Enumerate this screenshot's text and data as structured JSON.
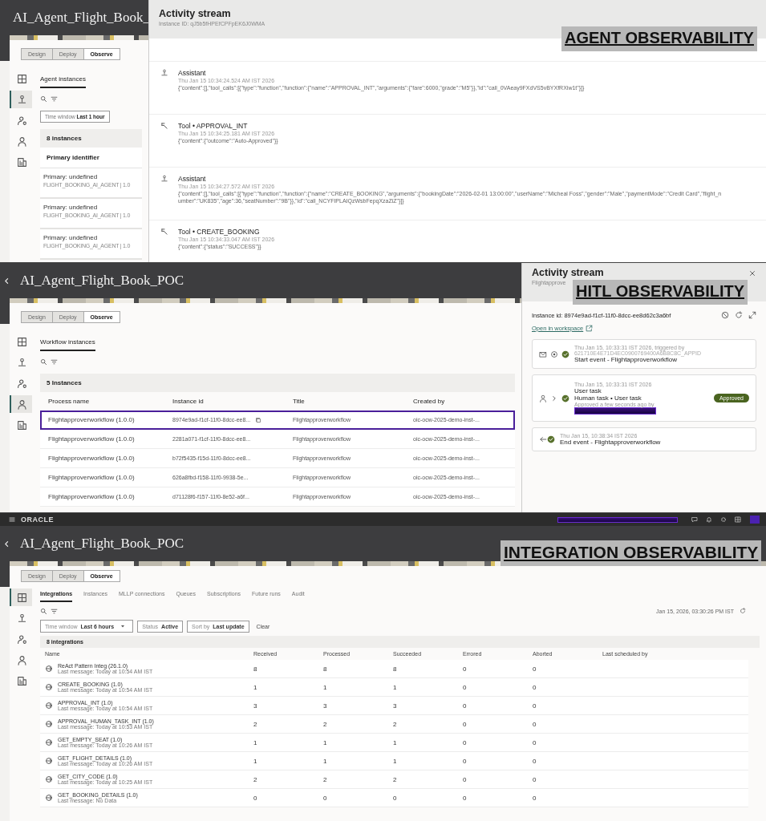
{
  "agent_panel": {
    "app_title": "AI_Agent_Flight_Book_",
    "mode_tabs": [
      {
        "label": "Design",
        "selected": false
      },
      {
        "label": "Deploy",
        "selected": false
      },
      {
        "label": "Observe",
        "selected": true
      }
    ],
    "nav": [
      {
        "kind": "grid",
        "selected": false
      },
      {
        "kind": "agent",
        "selected": true
      },
      {
        "kind": "workflow",
        "selected": false
      },
      {
        "kind": "person",
        "selected": false
      },
      {
        "kind": "report",
        "selected": false
      }
    ],
    "section_tab": "Agent instances",
    "filter": {
      "label": "Time window",
      "value": "Last 1 hour"
    },
    "count": "8 instances",
    "column": "Primary identifier",
    "rows": [
      {
        "primary": "Primary: undefined",
        "agent": "FLIGHT_BOOKING_AI_AGENT | 1.0"
      },
      {
        "primary": "Primary: undefined",
        "agent": "FLIGHT_BOOKING_AI_AGENT | 1.0"
      },
      {
        "primary": "Primary: undefined",
        "agent": "FLIGHT_BOOKING_AI_AGENT | 1.0"
      }
    ],
    "stream": {
      "title": "Activity stream",
      "subtitle": "Instance ID: qJ5b5fHPEfCPFpEK6J0WMA",
      "entries": [
        {
          "kind": "assistant",
          "role": "Assistant",
          "time": "Thu Jan 15 10:34:24.524 AM IST 2026",
          "body": "{\"content\":[],\"tool_calls\":[{\"type\":\"function\",\"function\":{\"name\":\"APPROVAL_INT\",\"arguments\":{\"fare\":6000,\"grade\":\"M5\"}},\"id\":\"call_0VAeay9FXdVS5vBYXfRXiw1t\"}]}"
        },
        {
          "kind": "tool",
          "role": "Tool • APPROVAL_INT",
          "time": "Thu Jan 15 10:34:25.181 AM IST 2026",
          "body": "{\"content\":{\"outcome\":\"Auto-Approved\"}}"
        },
        {
          "kind": "assistant",
          "role": "Assistant",
          "time": "Thu Jan 15 10:34:27.572 AM IST 2026",
          "body": "{\"content\":[],\"tool_calls\":[{\"type\":\"function\",\"function\":{\"name\":\"CREATE_BOOKING\",\"arguments\":{\"bookingDate\":\"2026-02-01 13:00:00\",\"userName\":\"Micheal Foss\",\"gender\":\"Male\",\"paymentMode\":\"Credit Card\",\"flight_number\":\"UK835\",\"age\":36,\"seatNumber\":\"9B\"}},\"id\":\"call_NCYFIPLAIQzWsbFepqXzaZiZ\"}]}"
        },
        {
          "kind": "tool",
          "role": "Tool • CREATE_BOOKING",
          "time": "Thu Jan 15 10:34:33.047 AM IST 2026",
          "body": "{\"content\":{\"status\":\"SUCCESS\"}}"
        }
      ]
    },
    "banner": "AGENT OBSERVABILITY"
  },
  "hitl_panel": {
    "app_title": "AI_Agent_Flight_Book_POC",
    "mode_tabs": [
      {
        "label": "Design",
        "selected": false
      },
      {
        "label": "Deploy",
        "selected": false
      },
      {
        "label": "Observe",
        "selected": true
      }
    ],
    "nav": [
      {
        "kind": "grid",
        "selected": false
      },
      {
        "kind": "agent",
        "selected": false
      },
      {
        "kind": "workflow",
        "selected": false
      },
      {
        "kind": "person",
        "selected": true
      },
      {
        "kind": "report",
        "selected": false
      }
    ],
    "section_tab": "Workflow instances",
    "count": "5 Instances",
    "columns": [
      "Process name",
      "Instance id",
      "Title",
      "Created by"
    ],
    "rows": [
      {
        "process": "Flightapproverworkflow (1.0.0)",
        "instance_id": "8974e9ad-f1cf-11f0-8dcc-ee8...",
        "title": "Flightapproverworkflow",
        "created_by": "oic-ocw-2025-demo-inst-...",
        "selected": true
      },
      {
        "process": "Flightapproverworkflow (1.0.0)",
        "instance_id": "2281a071-f1cf-11f0-8dcc-ee8...",
        "title": "Flightapproverworkflow",
        "created_by": "oic-ocw-2025-demo-inst-...",
        "selected": false
      },
      {
        "process": "Flightapproverworkflow (1.0.0)",
        "instance_id": "b72f5435-f15d-11f0-8dcc-ee8...",
        "title": "Flightapproverworkflow",
        "created_by": "oic-ocw-2025-demo-inst-...",
        "selected": false
      },
      {
        "process": "Flightapproverworkflow (1.0.0)",
        "instance_id": "626a8fbd-f158-11f0-9938-5e...",
        "title": "Flightapproverworkflow",
        "created_by": "oic-ocw-2025-demo-inst-...",
        "selected": false
      },
      {
        "process": "Flightapproverworkflow (1.0.0)",
        "instance_id": "d71128f6-f157-11f0-8e52-a6f...",
        "title": "Flightapproverworkflow",
        "created_by": "oic-ocw-2025-demo-inst-...",
        "selected": false
      }
    ],
    "stream": {
      "title": "Activity stream",
      "subtitle": "Flightapprove",
      "instance": "Instance id: 8974e9ad-f1cf-11f0-8dcc-ee8d62c3a6bf",
      "link": "Open in workspace",
      "events": [
        {
          "kind": "start",
          "time": "Thu Jan 15, 10:33:31 IST 2026, triggered by",
          "detail": "621710E4E71D4EC0900769400A6B8C8C_APPID",
          "title": "Start event - Flightapproverworkflow"
        },
        {
          "kind": "user_task",
          "time": "Thu Jan 15, 10:33:31 IST 2026",
          "title": "User task",
          "detail": "Human task • User task",
          "note": "Approved a few seconds ago by",
          "status": "Approved"
        },
        {
          "kind": "end",
          "time": "Thu Jan 15, 10:38:34 IST 2026",
          "title": "End event - Flightapproverworkflow"
        }
      ]
    },
    "banner": "HITL OBSERVABILITY"
  },
  "integration_panel": {
    "brand": "ORACLE",
    "app_title": "AI_Agent_Flight_Book_POC",
    "mode_tabs": [
      {
        "label": "Design",
        "selected": false
      },
      {
        "label": "Deploy",
        "selected": false
      },
      {
        "label": "Observe",
        "selected": true
      }
    ],
    "nav": [
      {
        "kind": "grid",
        "selected": true
      },
      {
        "kind": "agent",
        "selected": false
      },
      {
        "kind": "workflow",
        "selected": false
      },
      {
        "kind": "person",
        "selected": false
      },
      {
        "kind": "report",
        "selected": false
      }
    ],
    "tabs": [
      {
        "label": "Integrations",
        "selected": true
      },
      {
        "label": "Instances",
        "selected": false
      },
      {
        "label": "MLLP connections",
        "selected": false
      },
      {
        "label": "Queues",
        "selected": false
      },
      {
        "label": "Subscriptions",
        "selected": false
      },
      {
        "label": "Future runs",
        "selected": false
      },
      {
        "label": "Audit",
        "selected": false
      }
    ],
    "updated": "Jan 15, 2026, 03:30:26 PM IST",
    "filters": [
      {
        "kind": "dropdown",
        "label": "Time window",
        "value": "Last 6 hours"
      },
      {
        "kind": "chip",
        "label": "Status",
        "value": "Active"
      },
      {
        "kind": "chip",
        "label": "Sort by",
        "value": "Last update"
      }
    ],
    "clear": "Clear",
    "count": "8 integrations",
    "columns": [
      "Name",
      "Received",
      "Processed",
      "Succeeded",
      "Errored",
      "Aborted",
      "Last scheduled by"
    ],
    "rows": [
      {
        "name": "ReAct Pattern Integ (26.1.0)",
        "last_message": "Last message: Today at 10:54 AM IST",
        "values": [
          "8",
          "8",
          "8",
          "0",
          "0"
        ]
      },
      {
        "name": "CREATE_BOOKING (1.0)",
        "last_message": "Last message: Today at 10:54 AM IST",
        "values": [
          "1",
          "1",
          "1",
          "0",
          "0"
        ]
      },
      {
        "name": "APPROVAL_INT (1.0)",
        "last_message": "Last message: Today at 10:54 AM IST",
        "values": [
          "3",
          "3",
          "3",
          "0",
          "0"
        ]
      },
      {
        "name": "APPROVAL_HUMAN_TASK_INT (1.0)",
        "last_message": "Last message: Today at 10:53 AM IST",
        "values": [
          "2",
          "2",
          "2",
          "0",
          "0"
        ]
      },
      {
        "name": "GET_EMPTY_SEAT (1.0)",
        "last_message": "Last message: Today at 10:26 AM IST",
        "values": [
          "1",
          "1",
          "1",
          "0",
          "0"
        ]
      },
      {
        "name": "GET_FLIGHT_DETAILS (1.0)",
        "last_message": "Last message: Today at 10:26 AM IST",
        "values": [
          "1",
          "1",
          "1",
          "0",
          "0"
        ]
      },
      {
        "name": "GET_CITY_CODE (1.0)",
        "last_message": "Last message: Today at 10:25 AM IST",
        "values": [
          "2",
          "2",
          "2",
          "0",
          "0"
        ]
      },
      {
        "name": "GET_BOOKING_DETAILS (1.0)",
        "last_message": "Last message: No Data",
        "values": [
          "0",
          "0",
          "0",
          "0",
          "0"
        ]
      }
    ],
    "banner": "INTEGRATION OBSERVABILITY"
  }
}
